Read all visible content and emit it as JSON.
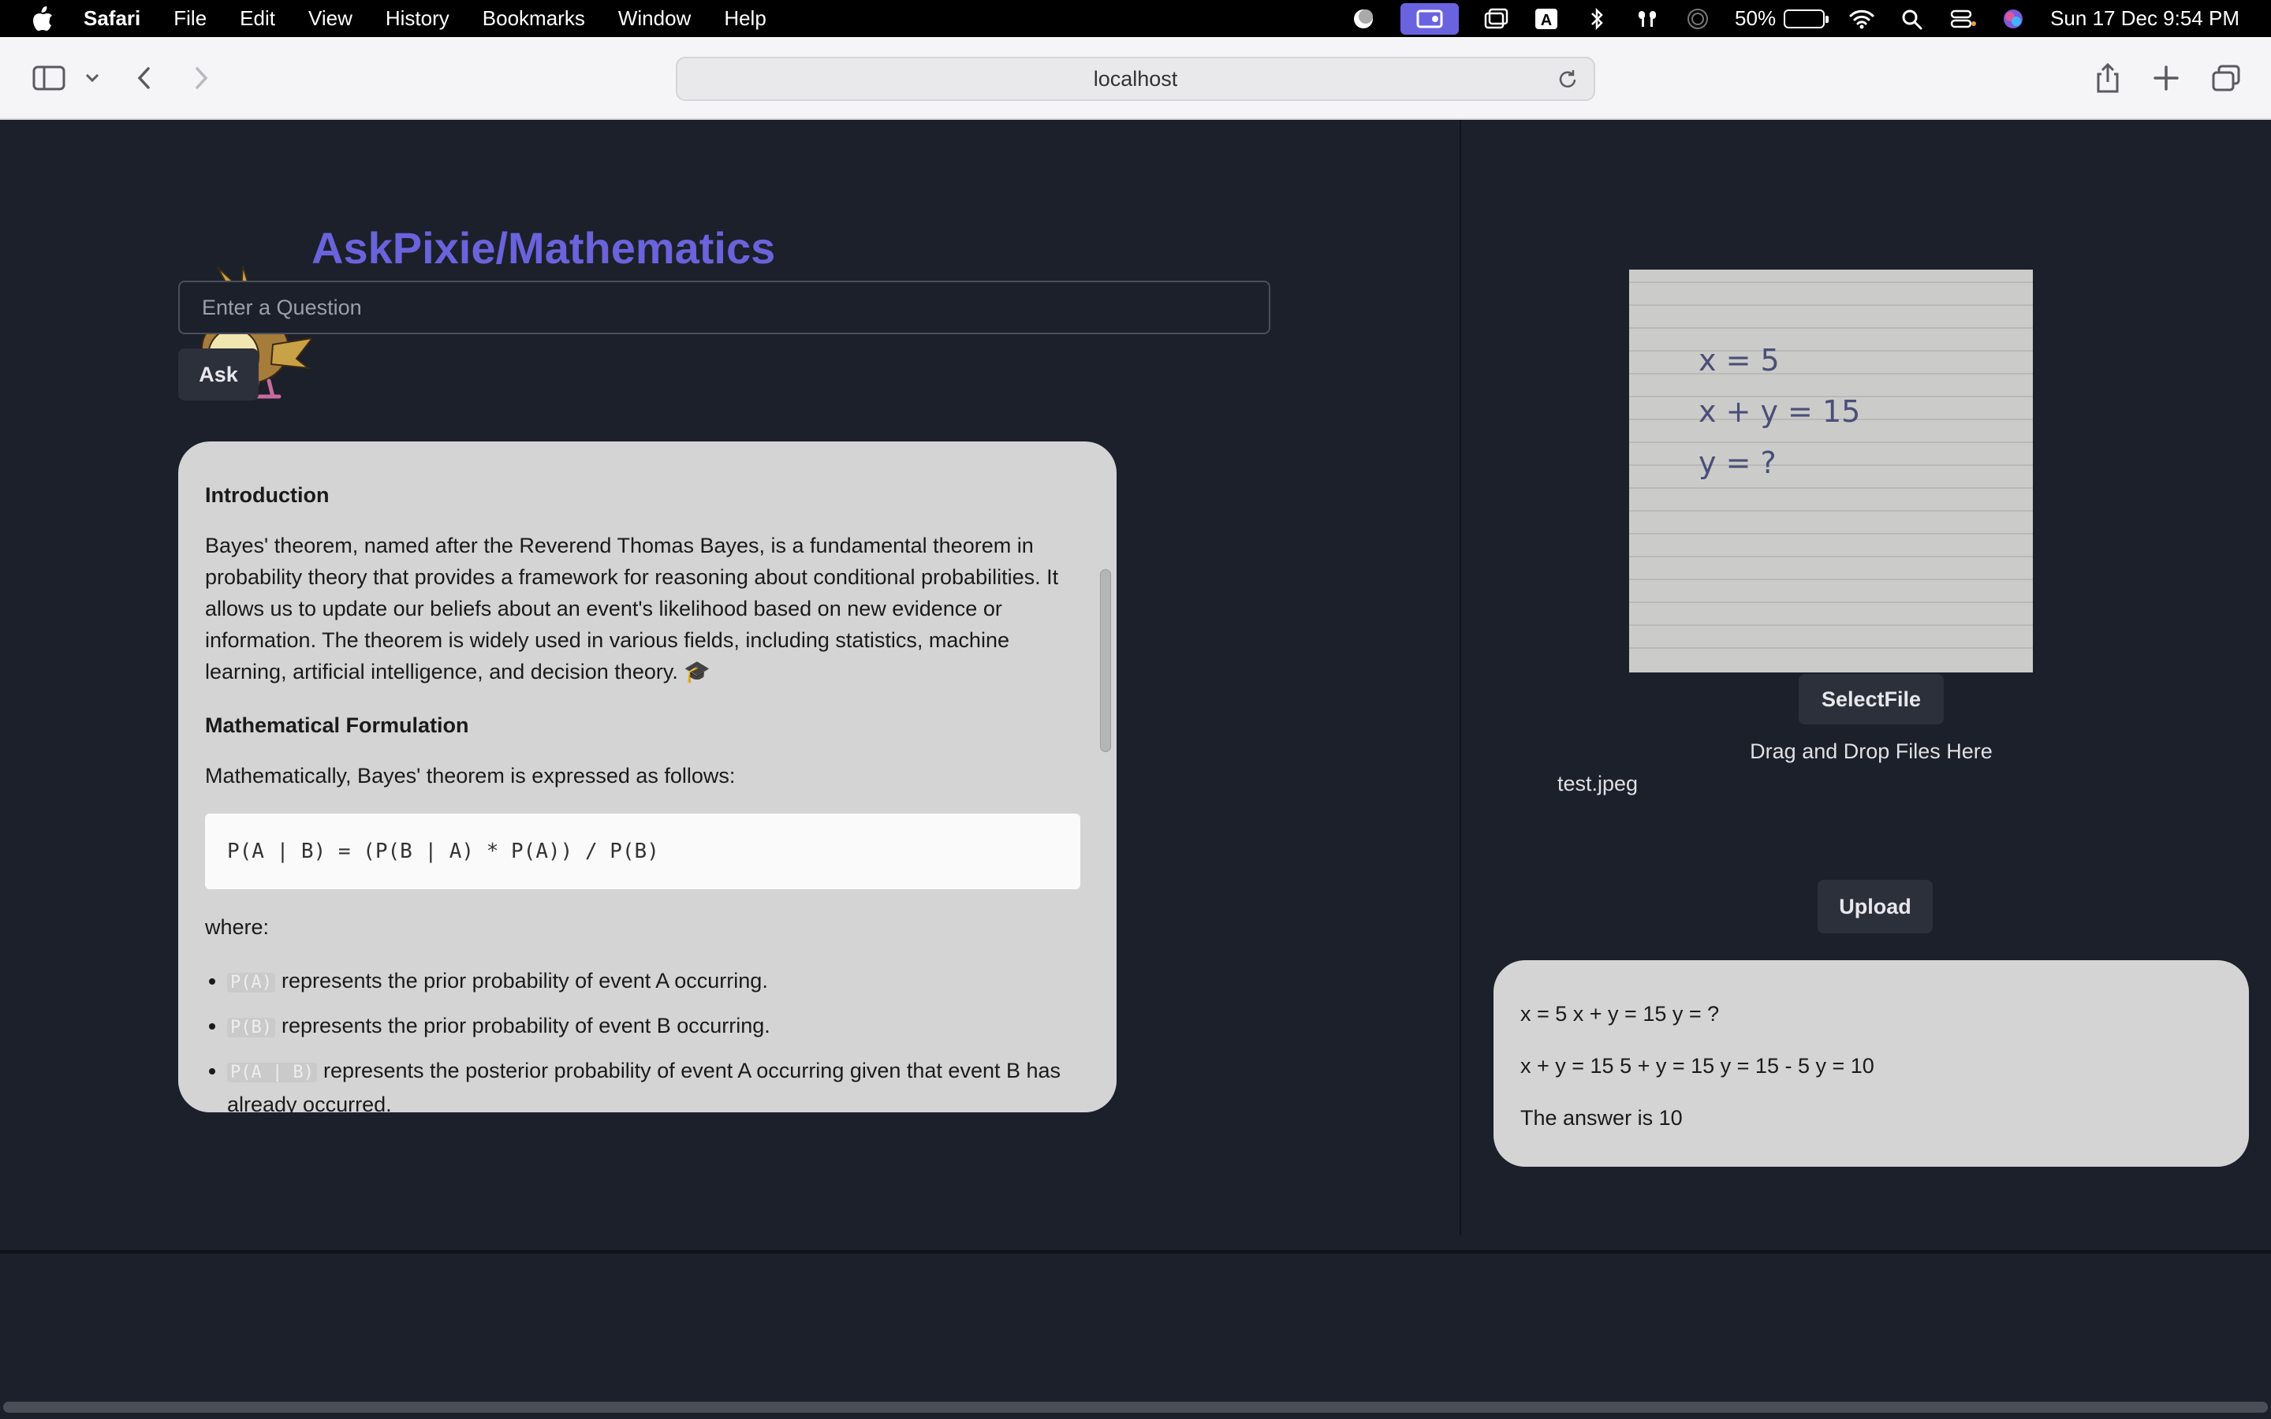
{
  "menubar": {
    "app_name": "Safari",
    "items": [
      "File",
      "Edit",
      "View",
      "History",
      "Bookmarks",
      "Window",
      "Help"
    ],
    "battery_percent": "50%",
    "battery_level": 0.5,
    "datetime": "Sun 17 Dec  9:54 PM",
    "status_icons": [
      "focus-icon",
      "screen-mirroring-icon",
      "window-icon",
      "keyboard-input-icon",
      "bluetooth-icon",
      "airpods-icon",
      "airdrop-icon",
      "wifi-icon",
      "spotlight-icon",
      "control-center-icon",
      "siri-icon"
    ]
  },
  "browser": {
    "url": "localhost",
    "icons": [
      "sidebar-icon",
      "chevron-down-icon",
      "back-icon",
      "forward-icon",
      "reload-icon",
      "share-icon",
      "new-tab-icon",
      "tabs-overview-icon"
    ]
  },
  "app": {
    "title": "AskPixie/Mathematics",
    "question_placeholder": "Enter a Question",
    "ask_label": "Ask"
  },
  "answer": {
    "intro_heading": "Introduction",
    "intro_text": "Bayes' theorem, named after the Reverend Thomas Bayes, is a fundamental theorem in probability theory that provides a framework for reasoning about conditional probabilities. It allows us to update our beliefs about an event's likelihood based on new evidence or information. The theorem is widely used in various fields, including statistics, machine learning, artificial intelligence, and decision theory. 🎓",
    "formulation_heading": "Mathematical Formulation",
    "formulation_text": "Mathematically, Bayes' theorem is expressed as follows:",
    "formula": "P(A | B) = (P(B | A) * P(A)) / P(B)",
    "where_label": "where:",
    "terms": [
      {
        "code": "P(A)",
        "text": "represents the prior probability of event A occurring."
      },
      {
        "code": "P(B)",
        "text": "represents the prior probability of event B occurring."
      },
      {
        "code": "P(A | B)",
        "text": "represents the posterior probability of event A occurring given that event B has already occurred."
      }
    ]
  },
  "upload": {
    "select_label": "SelectFile",
    "drop_hint": "Drag and Drop Files Here",
    "file_name": "test.jpeg",
    "upload_label": "Upload",
    "handwriting_lines": [
      "x = 5",
      "x + y = 15",
      "y = ?"
    ]
  },
  "result": {
    "lines": [
      "x = 5 x + y = 15 y = ?",
      "x + y = 15 5 + y = 15 y = 15 - 5 y = 10",
      "The answer is 10"
    ]
  },
  "colors": {
    "page_bg": "#1c202b",
    "accent": "#6a63db",
    "card_bg": "#d4d4d4",
    "button_bg": "#2c303b"
  }
}
